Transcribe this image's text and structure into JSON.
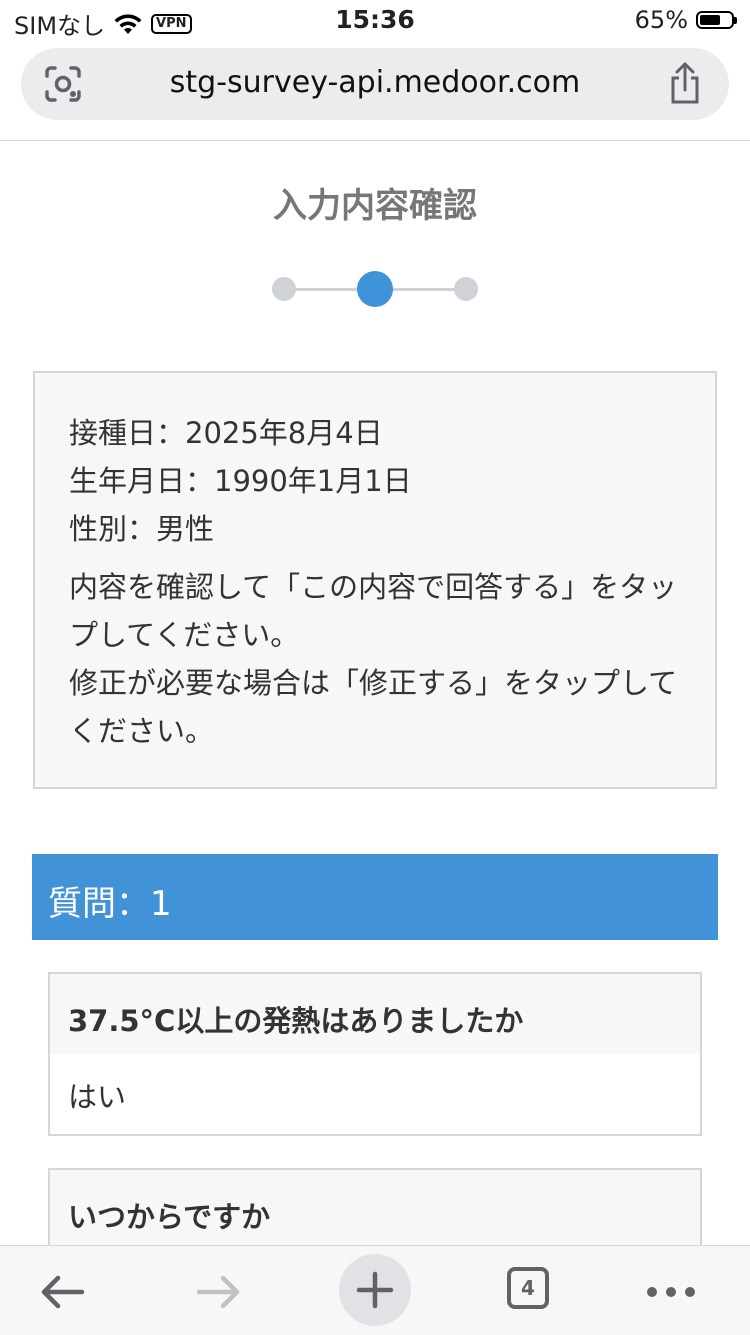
{
  "status_bar": {
    "carrier": "SIMなし",
    "vpn": "VPN",
    "time": "15:36",
    "battery": "65%",
    "battery_level": 0.65
  },
  "browser": {
    "url": "stg-survey-api.medoor.com",
    "tab_count": "4"
  },
  "page": {
    "title": "入力内容確認",
    "steps": {
      "total": 3,
      "current": 2
    }
  },
  "summary": {
    "vaccination_date": "接種日：2025年8月4日",
    "birth_date": "生年月日：1990年1月1日",
    "gender": "性別：男性",
    "note_line1": "内容を確認して「この内容で回答する」をタップしてください。",
    "note_line2": "修正が必要な場合は「修正する」をタップしてください。"
  },
  "question": {
    "header": "質問：1",
    "items": [
      {
        "q": "37.5°C以上の発熱はありましたか",
        "a": "はい"
      },
      {
        "q": "いつからですか",
        "a": ""
      }
    ]
  },
  "colors": {
    "accent": "#4192d6",
    "step_inactive": "#cfd2d7",
    "box_bg": "#f7f7f7"
  }
}
